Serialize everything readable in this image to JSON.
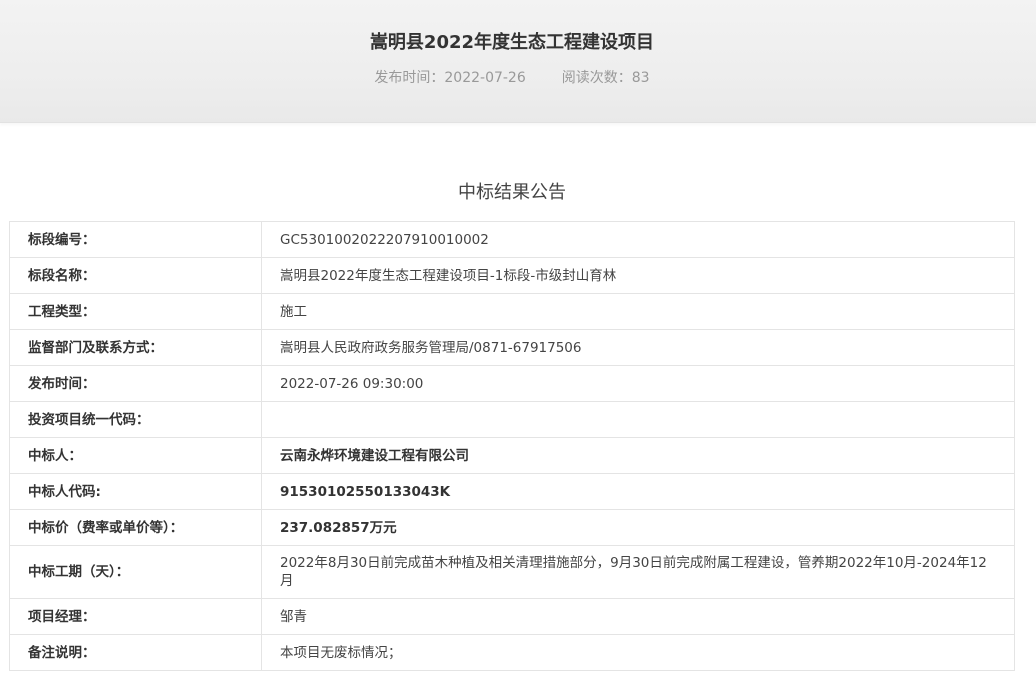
{
  "header": {
    "title": "嵩明县2022年度生态工程建设项目",
    "publish_time": "发布时间：2022-07-26",
    "read_count": "阅读次数：83"
  },
  "notice_title": "中标结果公告",
  "rows": [
    {
      "label": "标段编号：",
      "value": "GC5301002022207910010002"
    },
    {
      "label": "标段名称：",
      "value": "嵩明县2022年度生态工程建设项目-1标段-市级封山育林"
    },
    {
      "label": "工程类型：",
      "value": "施工"
    },
    {
      "label": "监督部门及联系方式：",
      "value": "嵩明县人民政府政务服务管理局/0871-67917506"
    },
    {
      "label": "发布时间：",
      "value": "2022-07-26 09:30:00"
    },
    {
      "label": "投资项目统一代码：",
      "value": ""
    },
    {
      "label": "中标人：",
      "value": "云南永烨环境建设工程有限公司"
    },
    {
      "label": "中标人代码:",
      "value": "91530102550133043K"
    },
    {
      "label": "中标价（费率或单价等）：",
      "value": "237.082857万元"
    },
    {
      "label": "中标工期（天）：",
      "value": "2022年8月30日前完成苗木种植及相关清理措施部分，9月30日前完成附属工程建设，管养期2022年10月-2024年12月"
    },
    {
      "label": "项目经理：",
      "value": "邹青"
    },
    {
      "label": "备注说明：",
      "value": "本项目无废标情况；"
    }
  ]
}
